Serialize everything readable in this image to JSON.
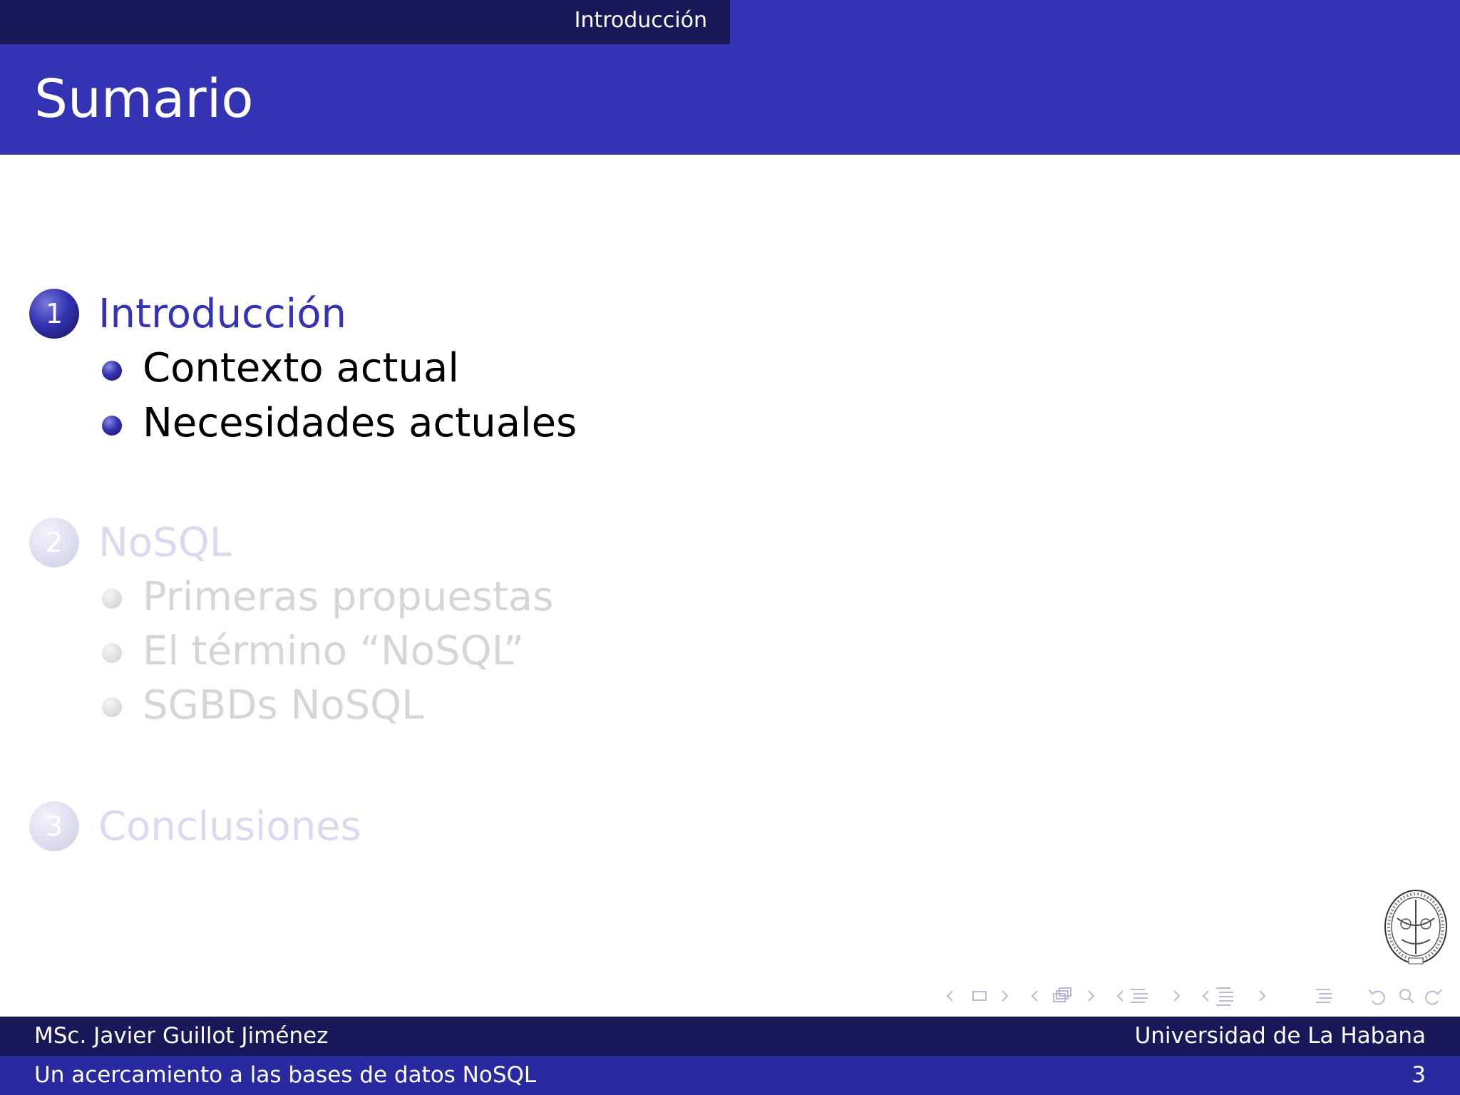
{
  "header": {
    "section": "Introducción",
    "title": "Sumario"
  },
  "toc": [
    {
      "number": "1",
      "title": "Introducción",
      "state": "active",
      "subsections": [
        "Contexto actual",
        "Necesidades actuales"
      ]
    },
    {
      "number": "2",
      "title": "NoSQL",
      "state": "faded",
      "subsections": [
        "Primeras propuestas",
        "El término “NoSQL”",
        "SGBDs NoSQL"
      ]
    },
    {
      "number": "3",
      "title": "Conclusiones",
      "state": "faded",
      "subsections": []
    }
  ],
  "navigation": {
    "icons": [
      "frame-prev-icon",
      "frame-icon",
      "frame-next-icon",
      "subsection-prev-icon",
      "subsection-icon",
      "subsection-next-icon",
      "section-prev-icon",
      "section-icon",
      "section-next-icon",
      "presentation-prev-icon",
      "presentation-icon",
      "presentation-next-icon",
      "toc-icon",
      "back-icon",
      "search-icon",
      "forward-icon"
    ]
  },
  "footer": {
    "author": "MSc. Javier Guillot Jiménez",
    "institution": "Universidad de La Habana",
    "talk_title": "Un acercamiento a las bases de datos NoSQL",
    "page_number": "3"
  },
  "colors": {
    "structure": "#3333b3",
    "dark": "#191959",
    "faded_text": "#d6d6d6"
  }
}
